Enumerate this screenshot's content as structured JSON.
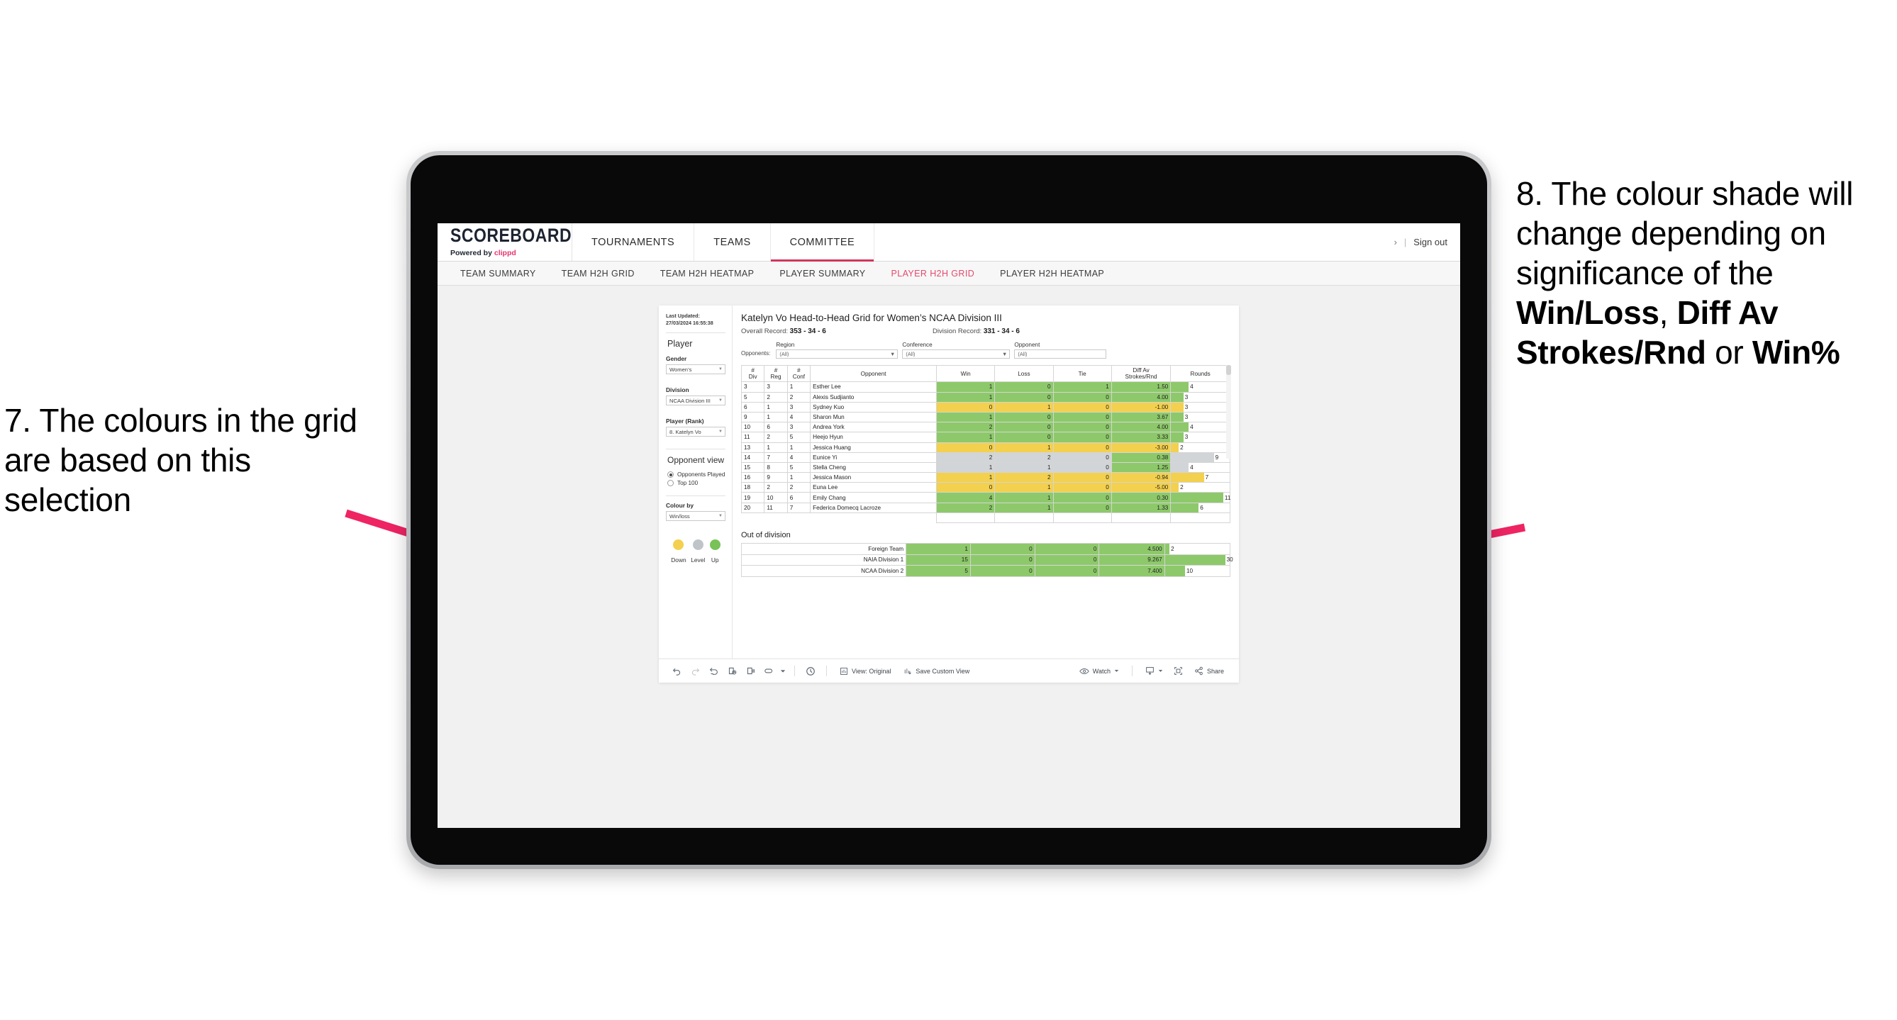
{
  "annotations": {
    "left": {
      "text": "7. The colours in the grid are based on this selection"
    },
    "right": {
      "pre": "8. The colour shade will change depending on significance of the ",
      "b1": "Win/Loss",
      "mid1": ", ",
      "b2": "Diff Av Strokes/Rnd",
      "mid2": " or ",
      "b3": "Win%"
    },
    "arrow_color": "#ee2463"
  },
  "app": {
    "brand": {
      "title": "SCOREBOARD",
      "powered": "Powered by",
      "vendor": "clippd"
    },
    "topnav": [
      {
        "label": "TOURNAMENTS",
        "active": false
      },
      {
        "label": "TEAMS",
        "active": false
      },
      {
        "label": "COMMITTEE",
        "active": true
      }
    ],
    "account": {
      "chevron": "›",
      "separator": "|",
      "sign_out": "Sign out"
    },
    "subnav": [
      {
        "label": "TEAM SUMMARY",
        "active": false
      },
      {
        "label": "TEAM H2H GRID",
        "active": false
      },
      {
        "label": "TEAM H2H HEATMAP",
        "active": false
      },
      {
        "label": "PLAYER SUMMARY",
        "active": false
      },
      {
        "label": "PLAYER H2H GRID",
        "active": true
      },
      {
        "label": "PLAYER H2H HEATMAP",
        "active": false
      }
    ]
  },
  "sidebar": {
    "last_updated": "Last Updated: 27/03/2024 16:55:38",
    "player_heading": "Player",
    "gender": {
      "label": "Gender",
      "value": "Women’s"
    },
    "division": {
      "label": "Division",
      "value": "NCAA Division III"
    },
    "player_rank": {
      "label": "Player (Rank)",
      "value": "8. Katelyn Vo"
    },
    "opponent_view": {
      "heading": "Opponent view",
      "options": [
        {
          "label": "Opponents Played",
          "selected": true
        },
        {
          "label": "Top 100",
          "selected": false
        }
      ]
    },
    "colour_by": {
      "label": "Colour by",
      "value": "Win/loss"
    },
    "legend": [
      {
        "label": "Down",
        "color": "#f3d04e"
      },
      {
        "label": "Level",
        "color": "#bfc4c8"
      },
      {
        "label": "Up",
        "color": "#78c258"
      }
    ]
  },
  "viz": {
    "title": "Katelyn Vo Head-to-Head Grid for Women’s NCAA Division III",
    "overall_record_label": "Overall Record:",
    "overall_record_value": "353 -  34 - 6",
    "division_record_label": "Division Record:",
    "division_record_value": "331 -  34 - 6",
    "opponents_label": "Opponents:",
    "filters": [
      {
        "caption": "Region",
        "value": "(All)"
      },
      {
        "caption": "Conference",
        "value": "(All)"
      },
      {
        "caption": "Opponent",
        "value": "(All)"
      }
    ],
    "columns": [
      "# Div",
      "# Reg",
      "# Conf",
      "Opponent",
      "Win",
      "Loss",
      "Tie",
      "Diff Av Strokes/Rnd",
      "Rounds"
    ],
    "column_lines": [
      [
        "#",
        "Div"
      ],
      [
        "#",
        "Reg"
      ],
      [
        "#",
        "Conf"
      ],
      [
        "Opponent",
        ""
      ],
      [
        "Win",
        ""
      ],
      [
        "Loss",
        ""
      ],
      [
        "Tie",
        ""
      ],
      [
        "Diff Av",
        "Strokes/Rnd"
      ],
      [
        "Rounds",
        ""
      ]
    ],
    "rows": [
      {
        "div": "3",
        "reg": "3",
        "conf": "1",
        "opponent": "Esther Lee",
        "win": "1",
        "loss": "0",
        "tie": "1",
        "diff": "1.50",
        "rounds": "4",
        "state": "up",
        "bar_pct": 30
      },
      {
        "div": "5",
        "reg": "2",
        "conf": "2",
        "opponent": "Alexis Sudjianto",
        "win": "1",
        "loss": "0",
        "tie": "0",
        "diff": "4.00",
        "rounds": "3",
        "state": "up",
        "bar_pct": 21
      },
      {
        "div": "6",
        "reg": "1",
        "conf": "3",
        "opponent": "Sydney Kuo",
        "win": "0",
        "loss": "1",
        "tie": "0",
        "diff": "-1.00",
        "rounds": "3",
        "state": "down",
        "bar_pct": 21
      },
      {
        "div": "9",
        "reg": "1",
        "conf": "4",
        "opponent": "Sharon Mun",
        "win": "1",
        "loss": "0",
        "tie": "0",
        "diff": "3.67",
        "rounds": "3",
        "state": "up",
        "bar_pct": 21
      },
      {
        "div": "10",
        "reg": "6",
        "conf": "3",
        "opponent": "Andrea York",
        "win": "2",
        "loss": "0",
        "tie": "0",
        "diff": "4.00",
        "rounds": "4",
        "state": "up",
        "bar_pct": 30
      },
      {
        "div": "11",
        "reg": "2",
        "conf": "5",
        "opponent": "Heejo Hyun",
        "win": "1",
        "loss": "0",
        "tie": "0",
        "diff": "3.33",
        "rounds": "3",
        "state": "up",
        "bar_pct": 21
      },
      {
        "div": "13",
        "reg": "1",
        "conf": "1",
        "opponent": "Jessica Huang",
        "win": "0",
        "loss": "1",
        "tie": "0",
        "diff": "-3.00",
        "rounds": "2",
        "state": "down",
        "bar_pct": 13
      },
      {
        "div": "14",
        "reg": "7",
        "conf": "4",
        "opponent": "Eunice Yi",
        "win": "2",
        "loss": "2",
        "tie": "0",
        "diff": "0.38",
        "rounds": "9",
        "state": "level",
        "diff_state": "up",
        "bar_pct": 73
      },
      {
        "div": "15",
        "reg": "8",
        "conf": "5",
        "opponent": "Stella Cheng",
        "win": "1",
        "loss": "1",
        "tie": "0",
        "diff": "1.25",
        "rounds": "4",
        "state": "level",
        "diff_state": "up",
        "bar_pct": 30
      },
      {
        "div": "16",
        "reg": "9",
        "conf": "1",
        "opponent": "Jessica Mason",
        "win": "1",
        "loss": "2",
        "tie": "0",
        "diff": "-0.94",
        "rounds": "7",
        "state": "down",
        "bar_pct": 56
      },
      {
        "div": "18",
        "reg": "2",
        "conf": "2",
        "opponent": "Euna Lee",
        "win": "0",
        "loss": "1",
        "tie": "0",
        "diff": "-5.00",
        "rounds": "2",
        "state": "down",
        "bar_pct": 13
      },
      {
        "div": "19",
        "reg": "10",
        "conf": "6",
        "opponent": "Emily Chang",
        "win": "4",
        "loss": "1",
        "tie": "0",
        "diff": "0.30",
        "rounds": "11",
        "state": "up",
        "bar_pct": 89
      },
      {
        "div": "20",
        "reg": "11",
        "conf": "7",
        "opponent": "Federica Domecq Lacroze",
        "win": "2",
        "loss": "1",
        "tie": "0",
        "diff": "1.33",
        "rounds": "6",
        "state": "up",
        "bar_pct": 47
      }
    ],
    "out_of_division": {
      "title": "Out of division",
      "rows": [
        {
          "name": "Foreign Team",
          "win": "1",
          "loss": "0",
          "tie": "0",
          "diff": "4.500",
          "rounds": "2",
          "state": "up",
          "bar_pct": 7
        },
        {
          "name": "NAIA Division 1",
          "win": "15",
          "loss": "0",
          "tie": "0",
          "diff": "9.267",
          "rounds": "30",
          "state": "up",
          "bar_pct": 93
        },
        {
          "name": "NCAA Division 2",
          "win": "5",
          "loss": "0",
          "tie": "0",
          "diff": "7.400",
          "rounds": "10",
          "state": "up",
          "bar_pct": 31
        }
      ]
    },
    "state_colors": {
      "up": "#8dc96a",
      "down": "#f3d04e",
      "level": "#d2d5d7",
      "none": "#ffffff"
    }
  },
  "toolbar": {
    "icons": [
      "undo-icon",
      "redo-icon",
      "revert-icon",
      "refresh-icon",
      "pause-icon",
      "rectangle-select-icon",
      "caret-down-icon",
      "clock-icon"
    ],
    "view_label": "View: Original",
    "save_custom_view": "Save Custom View",
    "watch": "Watch",
    "share": "Share"
  }
}
